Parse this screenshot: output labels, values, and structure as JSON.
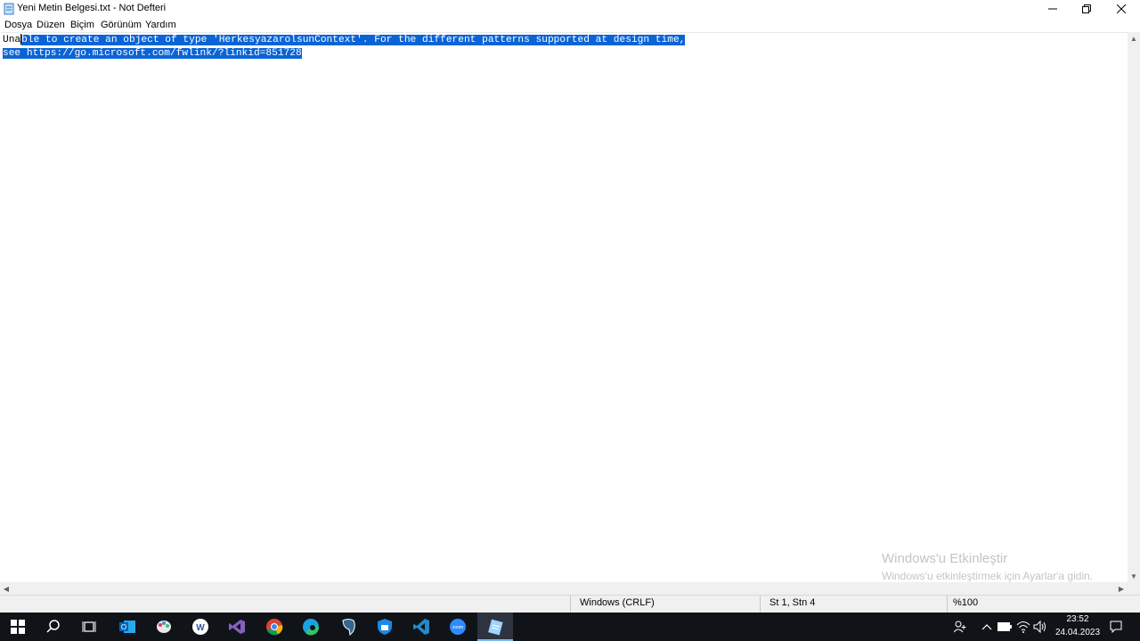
{
  "window": {
    "title": "Yeni Metin Belgesi.txt - Not Defteri"
  },
  "menu": {
    "items": [
      "Dosya",
      "Düzen",
      "Biçim",
      "Görünüm",
      "Yardım"
    ]
  },
  "editor": {
    "line1_plain": "Una",
    "line1_selected": "ble to create an object of type 'HerkesyazarolsunContext'. For the different patterns supported at design time,",
    "line2_selected": "see https://go.microsoft.com/fwlink/?linkid=851728"
  },
  "status": {
    "line_ending": "Windows (CRLF)",
    "position": "St 1, Stn 4",
    "zoom": "%100"
  },
  "watermark": {
    "title": "Windows'u Etkinleştir",
    "subtitle": "Windows'u etkinleştirmek için Ayarlar'a gidin."
  },
  "taskbar": {
    "apps": [
      "windows-start-icon",
      "search-icon",
      "task-view-icon",
      "outlook-icon",
      "paint-icon",
      "word-icon",
      "visual-studio-icon",
      "chrome-icon",
      "edge-icon",
      "pgadmin-icon",
      "vpn-shield-icon",
      "vscode-icon",
      "zoom-icon",
      "notepad-icon"
    ]
  },
  "clock": {
    "time": "23:52",
    "date": "24.04.2023"
  },
  "colors": {
    "selection": "#0a64d6",
    "taskbar": "#101418"
  }
}
